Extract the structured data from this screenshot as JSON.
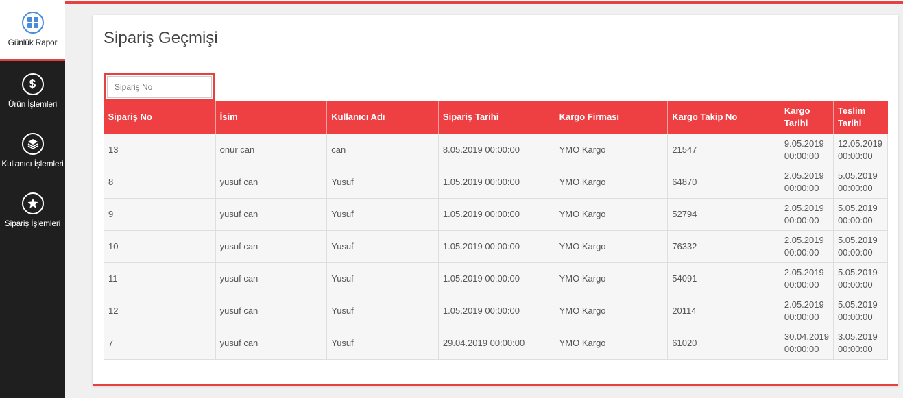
{
  "sidebar": {
    "items": [
      {
        "label": "Günlük Rapor",
        "icon": "dashboard-grid-icon"
      },
      {
        "label": "Ürün İşlemleri",
        "icon": "dollar-icon"
      },
      {
        "label": "Kullanıcı İşlemleri",
        "icon": "layers-icon"
      },
      {
        "label": "Sipariş İşlemleri",
        "icon": "star-icon"
      }
    ]
  },
  "page": {
    "title": "Sipariş Geçmişi"
  },
  "search": {
    "placeholder": "Sipariş No",
    "value": ""
  },
  "table": {
    "headers": [
      "Sipariş No",
      "İsim",
      "Kullanıcı Adı",
      "Sipariş Tarihi",
      "Kargo Firması",
      "Kargo Takip No",
      "Kargo Tarihi",
      "Teslim Tarihi"
    ],
    "rows": [
      [
        "13",
        "onur can",
        "can",
        "8.05.2019 00:00:00",
        "YMO Kargo",
        "21547",
        "9.05.2019 00:00:00",
        "12.05.2019 00:00:00"
      ],
      [
        "8",
        "yusuf can",
        "Yusuf",
        "1.05.2019 00:00:00",
        "YMO Kargo",
        "64870",
        "2.05.2019 00:00:00",
        "5.05.2019 00:00:00"
      ],
      [
        "9",
        "yusuf can",
        "Yusuf",
        "1.05.2019 00:00:00",
        "YMO Kargo",
        "52794",
        "2.05.2019 00:00:00",
        "5.05.2019 00:00:00"
      ],
      [
        "10",
        "yusuf can",
        "Yusuf",
        "1.05.2019 00:00:00",
        "YMO Kargo",
        "76332",
        "2.05.2019 00:00:00",
        "5.05.2019 00:00:00"
      ],
      [
        "11",
        "yusuf can",
        "Yusuf",
        "1.05.2019 00:00:00",
        "YMO Kargo",
        "54091",
        "2.05.2019 00:00:00",
        "5.05.2019 00:00:00"
      ],
      [
        "12",
        "yusuf can",
        "Yusuf",
        "1.05.2019 00:00:00",
        "YMO Kargo",
        "20114",
        "2.05.2019 00:00:00",
        "5.05.2019 00:00:00"
      ],
      [
        "7",
        "yusuf can",
        "Yusuf",
        "29.04.2019 00:00:00",
        "YMO Kargo",
        "61020",
        "30.04.2019 00:00:00",
        "3.05.2019 00:00:00"
      ]
    ]
  },
  "colors": {
    "accent": "#ee4043",
    "sidebar_bg": "#1f1f1f",
    "active_icon": "#4a8bdc"
  }
}
